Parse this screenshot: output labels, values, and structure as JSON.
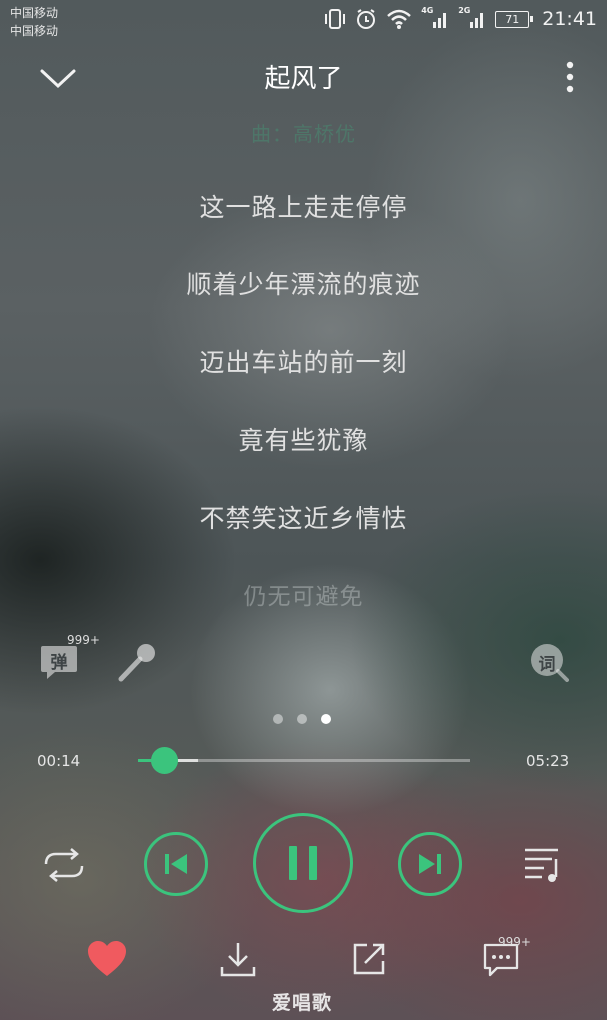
{
  "status_bar": {
    "carrier_1": "中国移动",
    "carrier_2": "中国移动",
    "network_1": "4G",
    "network_2": "2G",
    "battery": "71",
    "time": "21:41"
  },
  "header": {
    "title": "起风了"
  },
  "lyrics": {
    "composer_line": "曲：高桥优",
    "lines": [
      "这一路上走走停停",
      "顺着少年漂流的痕迹",
      "迈出车站的前一刻",
      "竟有些犹豫",
      "不禁笑这近乡情怯"
    ],
    "next_line": "仍无可避免"
  },
  "tools": {
    "danmaku_label": "弹",
    "danmaku_count": "999+",
    "lyrics_poster_label": "词"
  },
  "page_indicator": {
    "count": 3,
    "active": 3
  },
  "progress": {
    "current": "00:14",
    "total": "05:23",
    "fraction": 0.044
  },
  "actions": {
    "comment_count": "999+"
  },
  "accent_color": "#3bc47d",
  "like_color": "#f05a5f",
  "watermark": "爱唱歌"
}
